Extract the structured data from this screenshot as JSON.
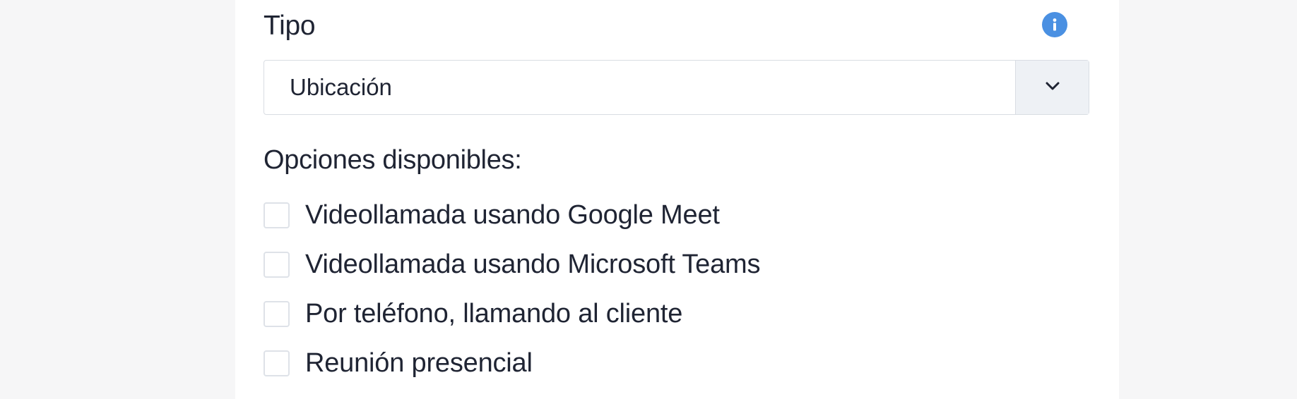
{
  "field": {
    "label": "Tipo",
    "info_icon": "info-icon",
    "select": {
      "value": "Ubicación",
      "arrow_icon": "chevron-down-icon"
    }
  },
  "options_section": {
    "title": "Opciones disponibles:",
    "items": [
      {
        "label": "Videollamada usando Google Meet",
        "checked": false
      },
      {
        "label": "Videollamada usando Microsoft Teams",
        "checked": false
      },
      {
        "label": "Por teléfono, llamando al cliente",
        "checked": false
      },
      {
        "label": "Reunión presencial",
        "checked": false
      }
    ]
  },
  "colors": {
    "accent": "#4a90e2",
    "background": "#f6f6f7",
    "panel": "#ffffff",
    "text": "#1f2433",
    "border": "#d9dde3"
  }
}
